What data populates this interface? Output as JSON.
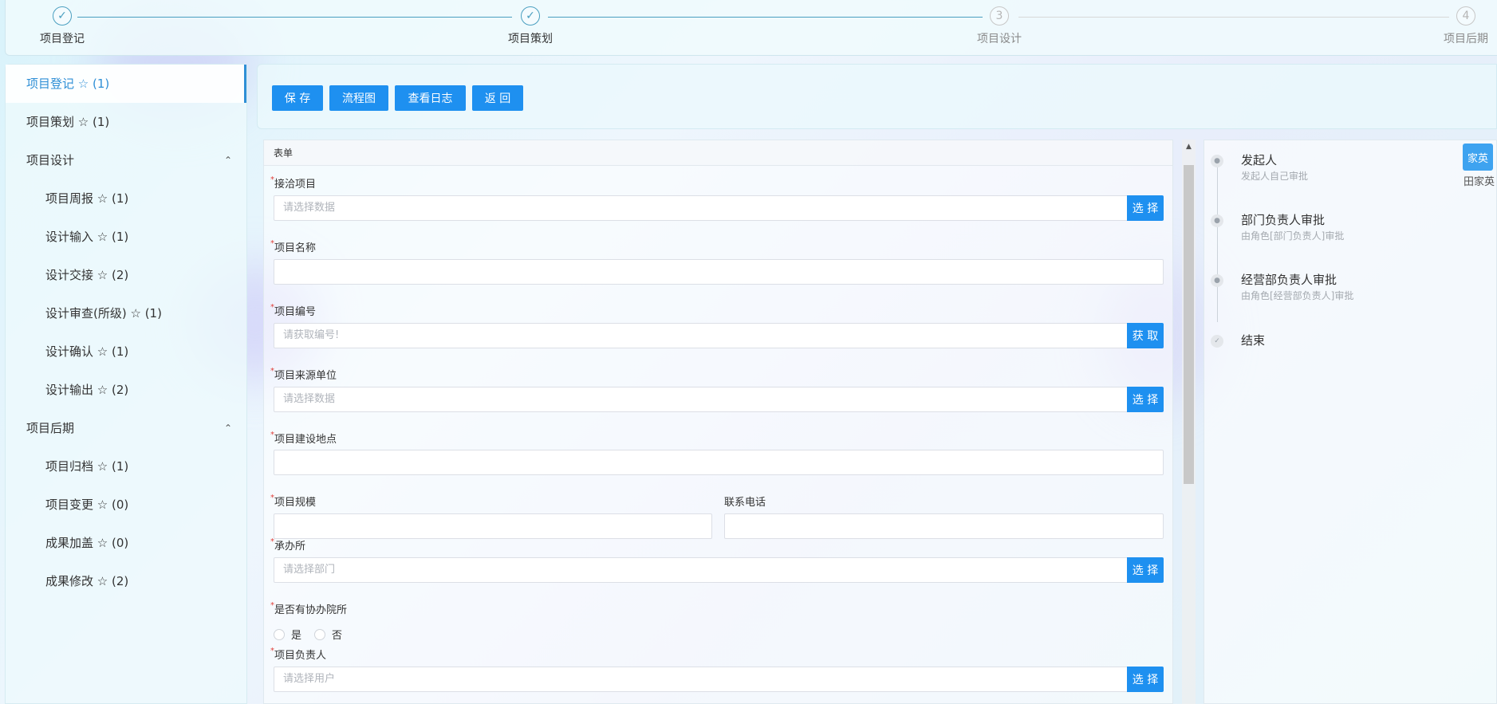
{
  "steps": [
    {
      "label": "项目登记",
      "icon": "✓"
    },
    {
      "label": "项目策划",
      "icon": "✓"
    },
    {
      "label": "项目设计",
      "icon": "3"
    },
    {
      "label": "项目后期",
      "icon": "4"
    }
  ],
  "sidebar": {
    "items": [
      {
        "label": "项目登记 ☆ (1)"
      },
      {
        "label": "项目策划 ☆ (1)"
      },
      {
        "label": "项目设计",
        "caret": "⌃"
      },
      {
        "label": "项目周报 ☆ (1)"
      },
      {
        "label": "设计输入 ☆ (1)"
      },
      {
        "label": "设计交接 ☆ (2)"
      },
      {
        "label": "设计审查(所级) ☆ (1)"
      },
      {
        "label": "设计确认 ☆ (1)"
      },
      {
        "label": "设计输出 ☆ (2)"
      },
      {
        "label": "项目后期",
        "caret": "⌃"
      },
      {
        "label": "项目归档 ☆ (1)"
      },
      {
        "label": "项目变更 ☆ (0)"
      },
      {
        "label": "成果加盖 ☆ (0)"
      },
      {
        "label": "成果修改 ☆ (2)"
      }
    ]
  },
  "toolbar": {
    "save": "保 存",
    "flowchart": "流程图",
    "view_log": "查看日志",
    "back": "返 回"
  },
  "form": {
    "header": "表单",
    "required_mark": "*",
    "fields": {
      "project": {
        "label": "接洽项目",
        "placeholder": "请选择数据",
        "button": "选 择"
      },
      "name": {
        "label": "项目名称",
        "placeholder": ""
      },
      "code": {
        "label": "项目编号",
        "placeholder": "请获取编号!",
        "button": "获 取"
      },
      "source_unit": {
        "label": "项目来源单位",
        "placeholder": "请选择数据",
        "button": "选 择"
      },
      "location": {
        "label": "项目建设地点",
        "placeholder": ""
      },
      "scale": {
        "label": "项目规模",
        "placeholder": ""
      },
      "phone": {
        "label": "联系电话",
        "placeholder": ""
      },
      "dept": {
        "label": "承办所",
        "placeholder": "请选择部门",
        "button": "选 择"
      },
      "assist": {
        "label": "是否有协办院所",
        "options": [
          "是",
          "否"
        ]
      },
      "leader": {
        "label": "项目负责人",
        "placeholder": "请选择用户",
        "button": "选 择"
      }
    }
  },
  "scrollbar": {
    "up_arrow": "▲"
  },
  "flow": {
    "nodes": [
      {
        "title": "发起人",
        "sub": "发起人自己审批",
        "icon": "person-icon"
      },
      {
        "title": "部门负责人审批",
        "sub": "由角色[部门负责人]审批",
        "icon": "person-icon"
      },
      {
        "title": "经营部负责人审批",
        "sub": "由角色[经营部负责人]审批",
        "icon": "person-icon"
      },
      {
        "title": "结束",
        "sub": "",
        "icon": "check-icon"
      }
    ],
    "avatar_text": "家英",
    "avatar_name": "田家英"
  },
  "colors": {
    "accent": "#1e90f0",
    "active": "#2f8fd6",
    "required": "#e0403a",
    "step_done": "#4a9fc0"
  }
}
